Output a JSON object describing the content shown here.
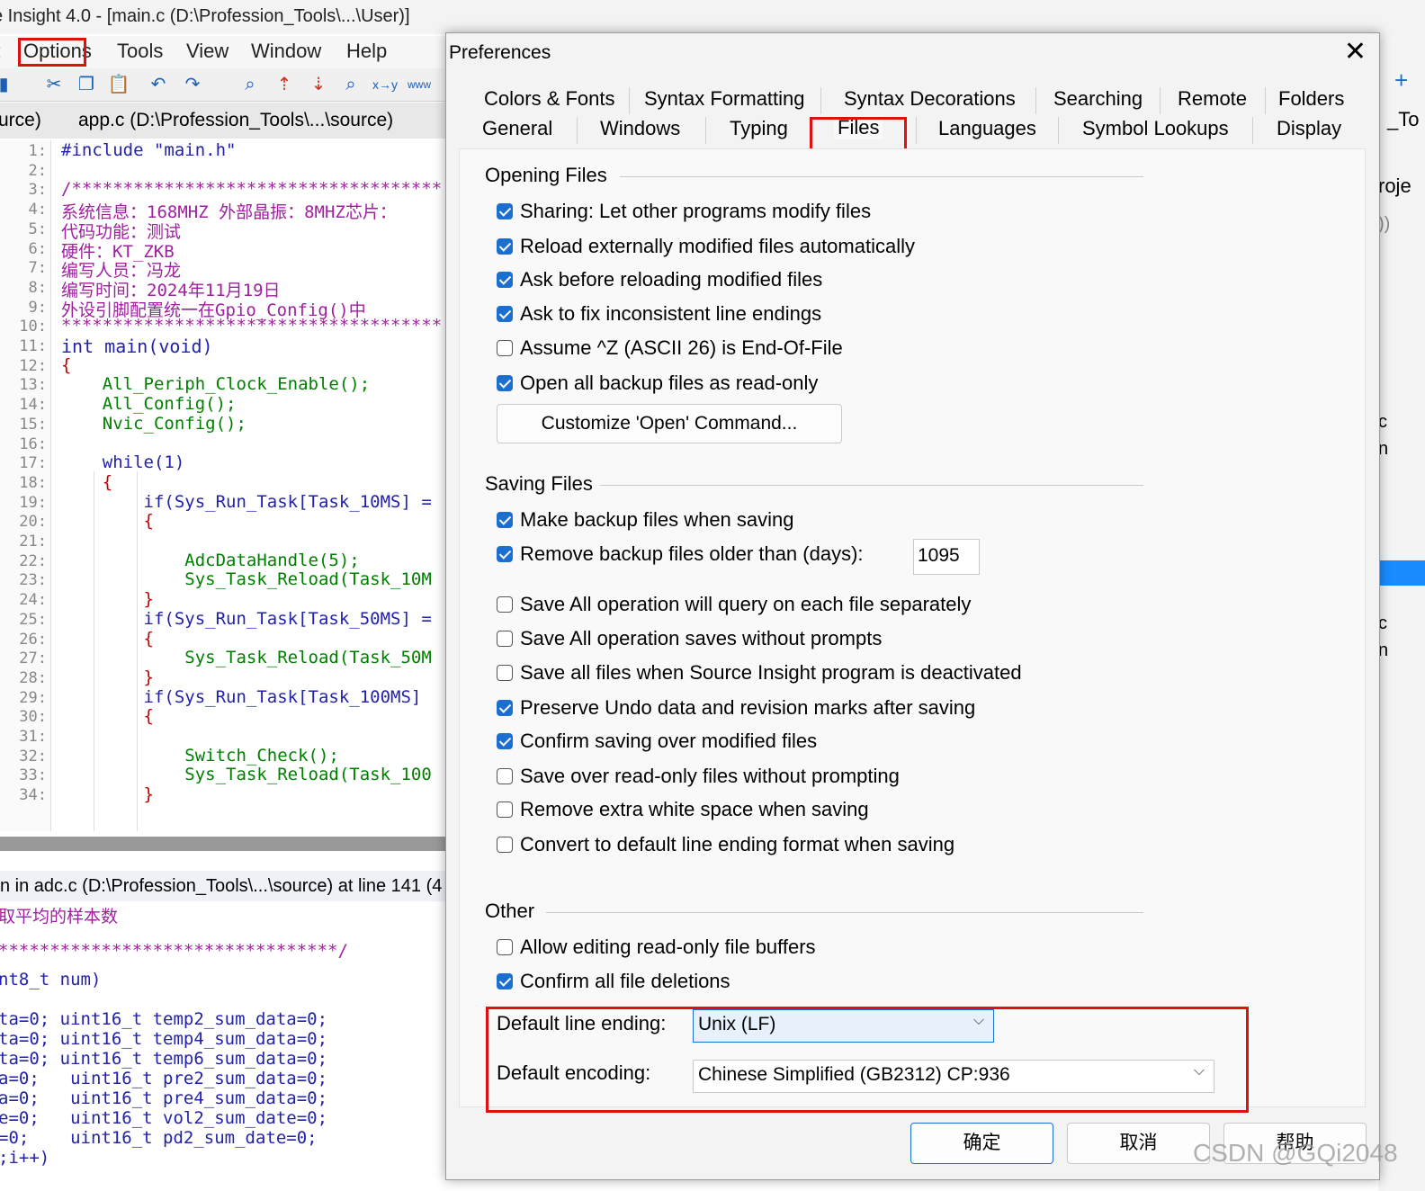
{
  "window_title": "e Insight 4.0 - [main.c (D:\\Profession_Tools\\...\\User)]",
  "menu": [
    "Options",
    "Tools",
    "View",
    "Window",
    "Help"
  ],
  "file_tabs": [
    "urce)",
    "app.c (D:\\Profession_Tools\\...\\source)"
  ],
  "editor": {
    "line_numbers": [
      "1:",
      "2:",
      "3:",
      "4:",
      "5:",
      "6:",
      "7:",
      "8:",
      "9:",
      "10:",
      "11:",
      "12:",
      "13:",
      "14:",
      "15:",
      "16:",
      "17:",
      "18:",
      "19:",
      "20:",
      "21:",
      "22:",
      "23:",
      "24:",
      "25:",
      "26:",
      "27:",
      "28:",
      "29:",
      "30:",
      "31:",
      "32:",
      "33:",
      "34:"
    ],
    "lines": [
      "#include \"main.h\"",
      "",
      "/************************************",
      "系统信息：168MHZ 外部晶振：8MHZ芯片：",
      "代码功能：测试",
      "硬件：KT_ZKB",
      "编写人员：冯龙",
      "编写时间：2024年11月19日",
      "外设引脚配置统一在Gpio_Config()中",
      "*************************************",
      "int main(void)",
      "{",
      "    All_Periph_Clock_Enable();",
      "    All_Config();",
      "    Nvic_Config();",
      "",
      "    while(1)",
      "    {",
      "        if(Sys_Run_Task[Task_10MS] =",
      "        {",
      "",
      "            AdcDataHandle(5);",
      "            Sys_Task_Reload(Task_10M",
      "        }",
      "        if(Sys_Run_Task[Task_50MS] =",
      "        {",
      "            Sys_Task_Reload(Task_50M",
      "        }",
      "        if(Sys_Run_Task[Task_100MS]",
      "        {",
      "",
      "            Switch_Check();",
      "            Sys_Task_Reload(Task_100",
      "        }"
    ]
  },
  "context": {
    "title": "n in adc.c (D:\\Profession_Tools\\...\\source) at line 141 (4",
    "lines": [
      "取平均的样本数",
      "",
      "*********************************/",
      "nt8_t num)",
      "",
      "ta=0; uint16_t temp2_sum_data=0;",
      "ta=0; uint16_t temp4_sum_data=0;",
      "ta=0; uint16_t temp6_sum_data=0;",
      "a=0;   uint16_t pre2_sum_data=0;",
      "a=0;   uint16_t pre4_sum_data=0;",
      "e=0;   uint16_t vol2_sum_date=0;",
      "=0;    uint16_t pd2_sum_date=0;",
      ";i++)"
    ]
  },
  "right_strip": [
    "+",
    "_To",
    "roje",
    "))",
    "c",
    "n",
    "c",
    "n"
  ],
  "dialog": {
    "title": "Preferences",
    "close": "✕",
    "tabs_row1": [
      "Colors & Fonts",
      "Syntax Formatting",
      "Syntax Decorations",
      "Searching",
      "Remote",
      "Folders"
    ],
    "tabs_row2": [
      "General",
      "Windows",
      "Typing",
      "Files",
      "Languages",
      "Symbol Lookups",
      "Display"
    ],
    "active_tab": "Files",
    "opening": {
      "heading": "Opening Files",
      "items": [
        {
          "label": "Sharing: Let other programs modify files",
          "checked": true
        },
        {
          "label": "Reload externally modified files automatically",
          "checked": true
        },
        {
          "label": "Ask before reloading modified files",
          "checked": true
        },
        {
          "label": "Ask to fix inconsistent line endings",
          "checked": true
        },
        {
          "label": "Assume ^Z (ASCII 26) is End-Of-File",
          "checked": false
        },
        {
          "label": "Open all backup files as read-only",
          "checked": true
        }
      ],
      "customize_button": "Customize 'Open' Command..."
    },
    "saving": {
      "heading": "Saving Files",
      "items": [
        {
          "label": "Make backup files when saving",
          "checked": true
        },
        {
          "label": "Remove backup files older than (days):",
          "checked": true
        },
        {
          "label": "Save All operation will query on each file separately",
          "checked": false
        },
        {
          "label": "Save All operation saves without prompts",
          "checked": false
        },
        {
          "label": "Save all files when Source Insight program is deactivated",
          "checked": false
        },
        {
          "label": "Preserve Undo data and revision marks after saving",
          "checked": true
        },
        {
          "label": "Confirm saving over modified files",
          "checked": true
        },
        {
          "label": "Save over read-only files without prompting",
          "checked": false
        },
        {
          "label": "Remove extra white space when saving",
          "checked": false
        },
        {
          "label": "Convert to default line ending format when saving",
          "checked": false
        }
      ],
      "days_value": "1095"
    },
    "other": {
      "heading": "Other",
      "items": [
        {
          "label": "Allow editing read-only file buffers",
          "checked": false
        },
        {
          "label": "Confirm all file deletions",
          "checked": true
        }
      ]
    },
    "line_ending": {
      "label": "Default line ending:",
      "value": "Unix (LF)"
    },
    "encoding": {
      "label": "Default encoding:",
      "value": "Chinese Simplified (GB2312)  CP:936"
    },
    "buttons": {
      "ok": "确定",
      "cancel": "取消",
      "help": "帮助"
    }
  },
  "watermark": "CSDN @GQi2048",
  "colors": {
    "accent": "#1a6fd1",
    "highlight_red": "#e01010",
    "keyword": "#2222aa",
    "comment": "#a020a0",
    "function": "#008000"
  }
}
